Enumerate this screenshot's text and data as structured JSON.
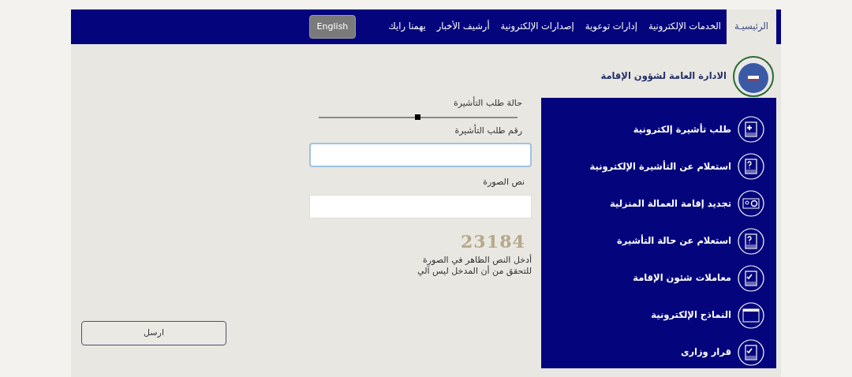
{
  "nav": {
    "items": [
      {
        "label": "الرئيسيـة",
        "selected": true
      },
      {
        "label": "الخدمات الإلكترونية",
        "selected": false
      },
      {
        "label": "إدارات توعوية",
        "selected": false
      },
      {
        "label": "إصدارات الإلكترونية",
        "selected": false
      },
      {
        "label": "أرشيف الأخبار",
        "selected": false
      },
      {
        "label": "يهمنا رايك",
        "selected": false
      }
    ],
    "language_button": "English"
  },
  "header": {
    "title": "الادارة العامة لشؤون الإقامة"
  },
  "sidebar": {
    "items": [
      {
        "label": "طلب تأشيرة إلكترونية",
        "kind": "plus"
      },
      {
        "label": "استعلام عن التأشيرة الإلكترونية",
        "kind": "question"
      },
      {
        "label": "تجديد إقامة العمالة المنزلية",
        "kind": "camera"
      },
      {
        "label": "استعلام عن حالة التأشيرة",
        "kind": "question"
      },
      {
        "label": "معاملات شئون الإقامة",
        "kind": "check"
      },
      {
        "label": "النماذج الإلكترونية",
        "kind": "form"
      },
      {
        "label": "قرار وزارى",
        "kind": "check"
      }
    ]
  },
  "form": {
    "status_label": "حالة طلب التأشيرة",
    "status_slider": {
      "level": 0.5
    },
    "visa_number": {
      "label": "رقم طلب التأشيرة",
      "focused": true
    },
    "captcha_field": {
      "label": "نص الصورة"
    },
    "captcha_image": "23184",
    "captcha_hint": "أدخل النص الظاهر في الصورة",
    "captcha_hint_2": "للتحقق من أن المدخل ليس آلي",
    "submit": "ارسل"
  }
}
